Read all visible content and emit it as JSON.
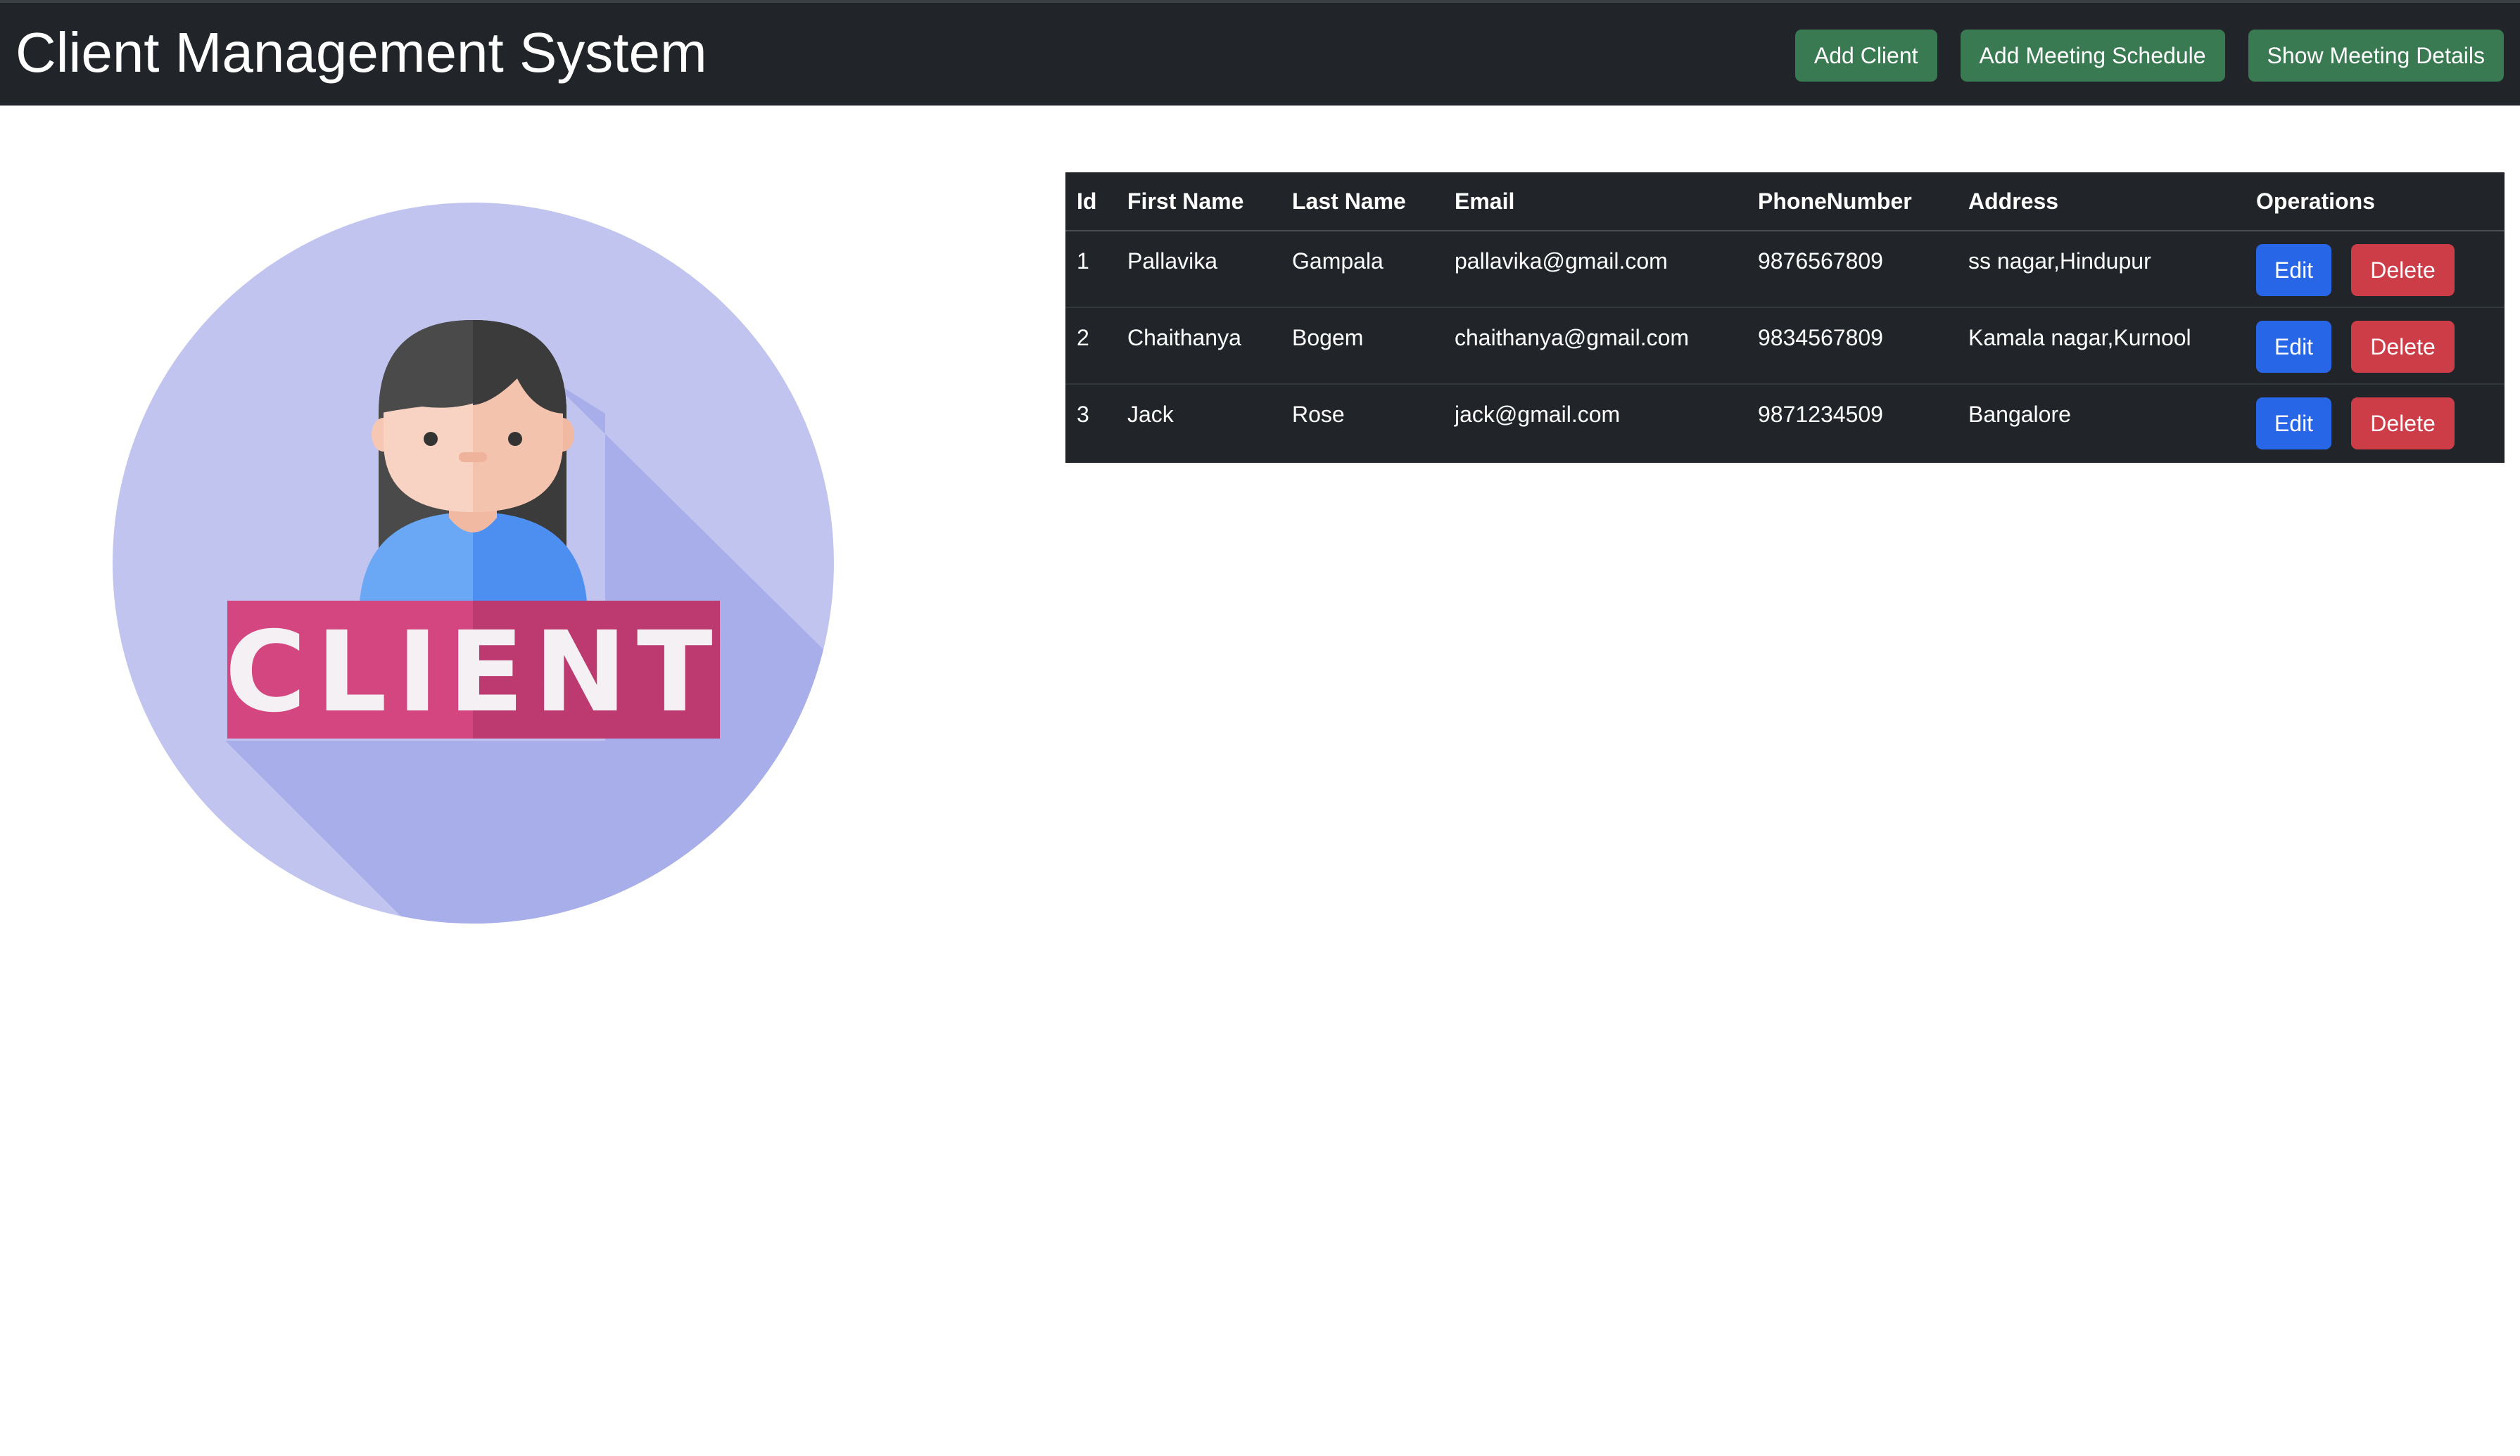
{
  "app": {
    "title": "Client Management System"
  },
  "nav": {
    "add_client": "Add Client",
    "add_meeting": "Add Meeting Schedule",
    "show_meetings": "Show Meeting Details"
  },
  "hero": {
    "badge_text": "CLIENT",
    "icon": "client-avatar-illustration"
  },
  "table": {
    "headers": {
      "id": "Id",
      "first_name": "First Name",
      "last_name": "Last Name",
      "email": "Email",
      "phone": "PhoneNumber",
      "address": "Address",
      "operations": "Operations"
    },
    "rows": [
      {
        "id": "1",
        "first_name": "Pallavika",
        "last_name": "Gampala",
        "email": "pallavika@gmail.com",
        "phone": "9876567809",
        "address": "ss nagar,Hindupur",
        "edit": "Edit",
        "delete": "Delete"
      },
      {
        "id": "2",
        "first_name": "Chaithanya",
        "last_name": "Bogem",
        "email": "chaithanya@gmail.com",
        "phone": "9834567809",
        "address": "Kamala nagar,Kurnool",
        "edit": "Edit",
        "delete": "Delete"
      },
      {
        "id": "3",
        "first_name": "Jack",
        "last_name": "Rose",
        "email": "jack@gmail.com",
        "phone": "9871234509",
        "address": "Bangalore",
        "edit": "Edit",
        "delete": "Delete"
      }
    ]
  },
  "colors": {
    "navbar": "#212529",
    "success": "#3a7a52",
    "primary": "#2866e8",
    "danger": "#cc3d48"
  }
}
